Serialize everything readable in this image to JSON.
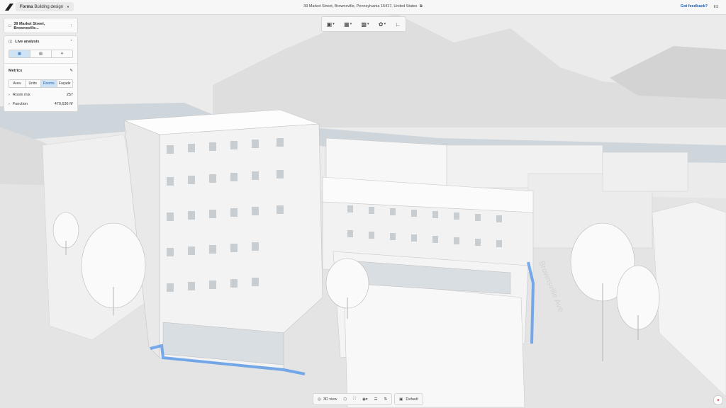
{
  "app": {
    "name": "Forma",
    "product": "Building design"
  },
  "address": "39 Market Street, Brownsville, Pennsylvania 15417, United States",
  "feedback_label": "Got feedback?",
  "avatar_initials": "ES",
  "project_panel": {
    "title": "39 Market Street, Brownsville..."
  },
  "analysis_panel": {
    "title": "Live analysis",
    "metrics_title": "Metrics",
    "tabs": [
      "Area",
      "Units",
      "Rooms",
      "Façade"
    ],
    "active_tab": "Rooms",
    "rows": [
      {
        "label": "Room mix",
        "value": "257"
      },
      {
        "label": "Function",
        "value": "470,636 ft²"
      }
    ]
  },
  "street_label": "Brownsville Ave",
  "bottom_bar": {
    "view_label": "3D view",
    "default_label": "Default"
  },
  "colors": {
    "accent": "#1a5fb4",
    "highlight": "#4f93e8",
    "ground": "#e9eaeb"
  }
}
